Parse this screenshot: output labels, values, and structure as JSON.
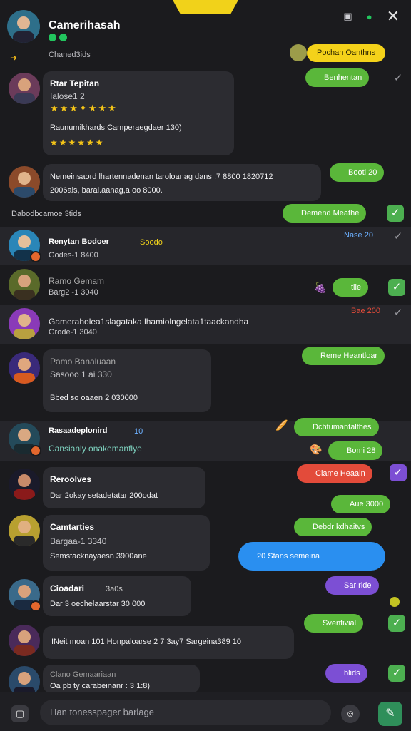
{
  "header": {
    "title": "Camerihasah",
    "subtitle": "Chaned3ids",
    "pill_label": "Pochan Oanthns",
    "colors": {
      "accent": "#f4d21a",
      "green": "#5ab73a",
      "bg": "#1b1b1e"
    }
  },
  "messages": [
    {
      "name": "Rtar Tepitan",
      "line1": "Ialose1 2",
      "line2": "Raunumikhards Camperaegdaer 130)",
      "rating": "★★★★★★"
    },
    {
      "text1": "Nemeinsaord lhartennadenan taroloanag dans :7 8800 1820712",
      "text2": "2006als, baral.aanag,a oo 8000."
    },
    {
      "name": "Renytan Bodoer",
      "meta": "Godes-1 8400",
      "tag": "Soodo"
    },
    {
      "name": "Ramo Gemam",
      "meta": "Barg2 -1 3040"
    },
    {
      "text1": "Gameraholea1slagataka lhamiolngelata1taackandha",
      "meta": "Grode-1 3040"
    },
    {
      "name": "Pamo Banaluaan",
      "meta": "Sasooo 1 ai 330",
      "line2": "Bbed so oaaen 2  030000"
    },
    {
      "name": "Rasaadeplonird",
      "tag": "10",
      "line2": "Cansianly onakemanflye"
    },
    {
      "name": "Reroolves",
      "line2": "Dar 2okay setadetatar 200odat"
    },
    {
      "name": "Camtarties",
      "meta": "Bargaa-1 3340",
      "line2": "Semstacknayaesn 3900ane"
    },
    {
      "name": "Cioadari",
      "tag": "3a0s",
      "line2": "Dar 3 oechelaarstar 30 000"
    },
    {
      "text1": "INeit moan 101 Honpaloarse 2 7 3ay7 Sargeina389 10"
    },
    {
      "name": "Clano Gemaariaan",
      "line2": "Oa pb ty carabeinanr : 3 1:8)"
    }
  ],
  "replies": [
    {
      "label": "Benhentan",
      "style": "green"
    },
    {
      "label": "Booti 20",
      "style": "green"
    },
    {
      "label": "Demend Meathe",
      "style": "green"
    },
    {
      "label": "Nase 20",
      "style": "status"
    },
    {
      "label": "tile",
      "style": "green"
    },
    {
      "label": "Bae 200",
      "style": "status"
    },
    {
      "label": "Reme Heantloar",
      "style": "green"
    },
    {
      "label": "Dchtumantalthes",
      "style": "green"
    },
    {
      "label": "Bomi 28",
      "style": "green"
    },
    {
      "label": "Clame Heaain",
      "style": "red"
    },
    {
      "label": "Aue 3000",
      "style": "green"
    },
    {
      "label": "Debdr kdhaitvs",
      "style": "green"
    },
    {
      "label": "20  Stans  semeina",
      "style": "blue"
    },
    {
      "label": "Sar ride",
      "style": "purple"
    },
    {
      "label": "Svenfivial",
      "style": "green"
    },
    {
      "label": "blids",
      "style": "purple"
    }
  ],
  "status_line": "Dabodbcamoe 3tids",
  "composer": {
    "placeholder": "Han tonesspager barlage"
  }
}
